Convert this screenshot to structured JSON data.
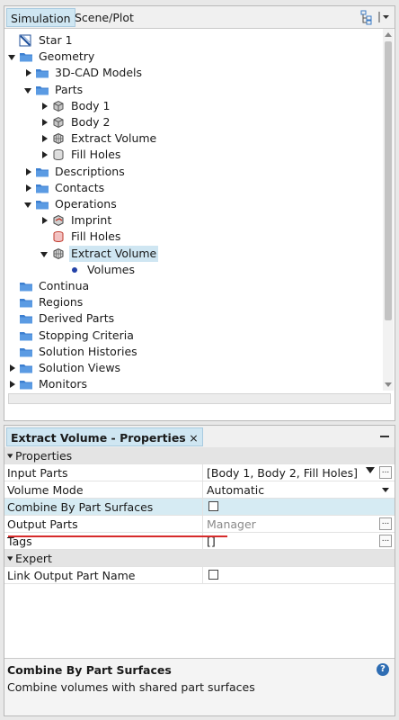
{
  "top_tabs": [
    "Simulation",
    "Scene/Plot"
  ],
  "tree": [
    {
      "label": "Star 1",
      "indent": 0,
      "toggle": "none",
      "icon": "sim-icon"
    },
    {
      "label": "Geometry",
      "indent": 0,
      "toggle": "down",
      "icon": "folder-icon"
    },
    {
      "label": "3D-CAD Models",
      "indent": 1,
      "toggle": "right",
      "icon": "folder-icon"
    },
    {
      "label": "Parts",
      "indent": 1,
      "toggle": "down",
      "icon": "folder-icon"
    },
    {
      "label": "Body 1",
      "indent": 2,
      "toggle": "right",
      "icon": "body-icon"
    },
    {
      "label": "Body 2",
      "indent": 2,
      "toggle": "right",
      "icon": "body-icon"
    },
    {
      "label": "Extract Volume",
      "indent": 2,
      "toggle": "right",
      "icon": "mesh-part-icon"
    },
    {
      "label": "Fill Holes",
      "indent": 2,
      "toggle": "right",
      "icon": "cylinder-icon"
    },
    {
      "label": "Descriptions",
      "indent": 1,
      "toggle": "right",
      "icon": "folder-icon"
    },
    {
      "label": "Contacts",
      "indent": 1,
      "toggle": "right",
      "icon": "folder-icon"
    },
    {
      "label": "Operations",
      "indent": 1,
      "toggle": "down",
      "icon": "folder-icon"
    },
    {
      "label": "Imprint",
      "indent": 2,
      "toggle": "right",
      "icon": "imprint-icon"
    },
    {
      "label": "Fill Holes",
      "indent": 2,
      "toggle": "none",
      "icon": "fill-holes-icon"
    },
    {
      "label": "Extract Volume",
      "indent": 2,
      "toggle": "down",
      "icon": "mesh-part-icon",
      "selected": true
    },
    {
      "label": "Volumes",
      "indent": 3,
      "toggle": "none",
      "icon": "dot-icon"
    },
    {
      "label": "Continua",
      "indent": 0,
      "toggle": "none",
      "icon": "folder-icon"
    },
    {
      "label": "Regions",
      "indent": 0,
      "toggle": "none",
      "icon": "folder-icon"
    },
    {
      "label": "Derived Parts",
      "indent": 0,
      "toggle": "none",
      "icon": "folder-icon"
    },
    {
      "label": "Stopping Criteria",
      "indent": 0,
      "toggle": "none",
      "icon": "folder-icon"
    },
    {
      "label": "Solution Histories",
      "indent": 0,
      "toggle": "none",
      "icon": "folder-icon"
    },
    {
      "label": "Solution Views",
      "indent": 0,
      "toggle": "right",
      "icon": "folder-icon"
    },
    {
      "label": "Monitors",
      "indent": 0,
      "toggle": "right",
      "icon": "folder-icon"
    }
  ],
  "properties": {
    "tab_title": "Extract Volume - Properties",
    "tab_close": "×",
    "rows": [
      {
        "kind": "cat",
        "name": "Properties"
      },
      {
        "kind": "prop",
        "name": "Input Parts",
        "value": "[Body 1, Body 2, Fill Holes]",
        "filter": true,
        "dots": true
      },
      {
        "kind": "prop",
        "name": "Volume Mode",
        "value": "Automatic",
        "dropdown": true
      },
      {
        "kind": "prop",
        "name": "Combine By Part Surfaces",
        "checkbox": true,
        "highlight": true
      },
      {
        "kind": "prop",
        "name": "Output Parts",
        "value": "Manager",
        "muted": true,
        "dots": true
      },
      {
        "kind": "prop",
        "name": "Tags",
        "value": "[]",
        "dots": true
      },
      {
        "kind": "cat",
        "name": "Expert"
      },
      {
        "kind": "prop",
        "name": "Link Output Part Name",
        "checkbox": true
      }
    ],
    "description": {
      "title": "Combine By Part Surfaces",
      "text": "Combine volumes with shared part surfaces"
    }
  },
  "colors": {
    "selection": "#cfe6f2",
    "folder": "#3c7fd0",
    "annotation_line": "#d62b2b"
  }
}
